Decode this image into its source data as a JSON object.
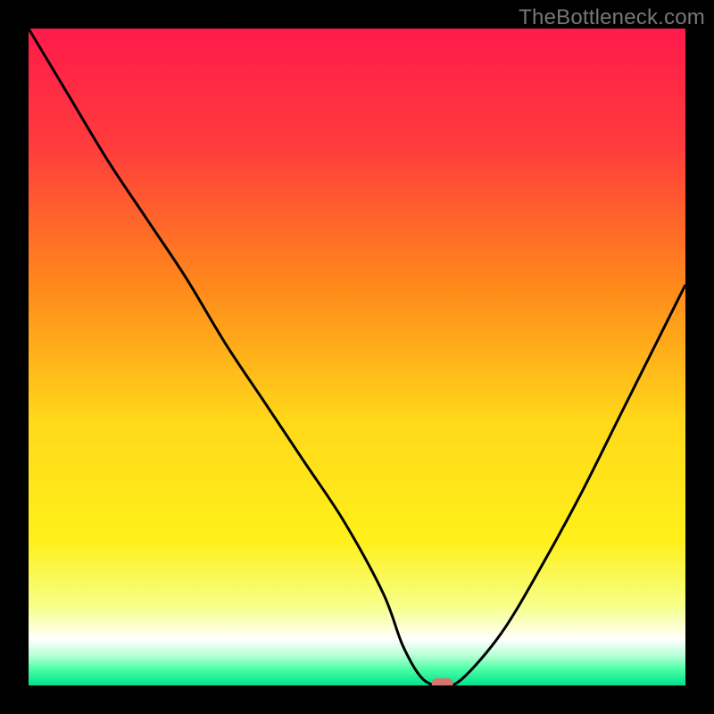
{
  "watermark": "TheBottleneck.com",
  "chart_data": {
    "type": "line",
    "title": "",
    "xlabel": "",
    "ylabel": "",
    "xlim": [
      0,
      100
    ],
    "ylim": [
      0,
      100
    ],
    "x": [
      0,
      6,
      12,
      18,
      24,
      30,
      36,
      42,
      48,
      54,
      57,
      60,
      63,
      66,
      72,
      78,
      84,
      90,
      96,
      100
    ],
    "values": [
      100,
      90,
      80,
      71,
      62,
      52,
      43,
      34,
      25,
      14,
      6,
      1,
      0,
      1,
      8,
      18,
      29,
      41,
      53,
      61
    ],
    "minimum_marker": {
      "x": 63,
      "y": 0
    },
    "gradient_stops": [
      {
        "offset": 0.0,
        "color": "#ff1a4b"
      },
      {
        "offset": 0.18,
        "color": "#ff3c3c"
      },
      {
        "offset": 0.4,
        "color": "#ff8c1a"
      },
      {
        "offset": 0.6,
        "color": "#ffd91a"
      },
      {
        "offset": 0.78,
        "color": "#fff01a"
      },
      {
        "offset": 0.88,
        "color": "#f7ff8a"
      },
      {
        "offset": 0.93,
        "color": "#ffffff"
      },
      {
        "offset": 0.955,
        "color": "#b4ffd4"
      },
      {
        "offset": 0.975,
        "color": "#4dffa8"
      },
      {
        "offset": 1.0,
        "color": "#00e28a"
      }
    ],
    "marker_color": "#d6756e",
    "curve_color": "#000000"
  }
}
